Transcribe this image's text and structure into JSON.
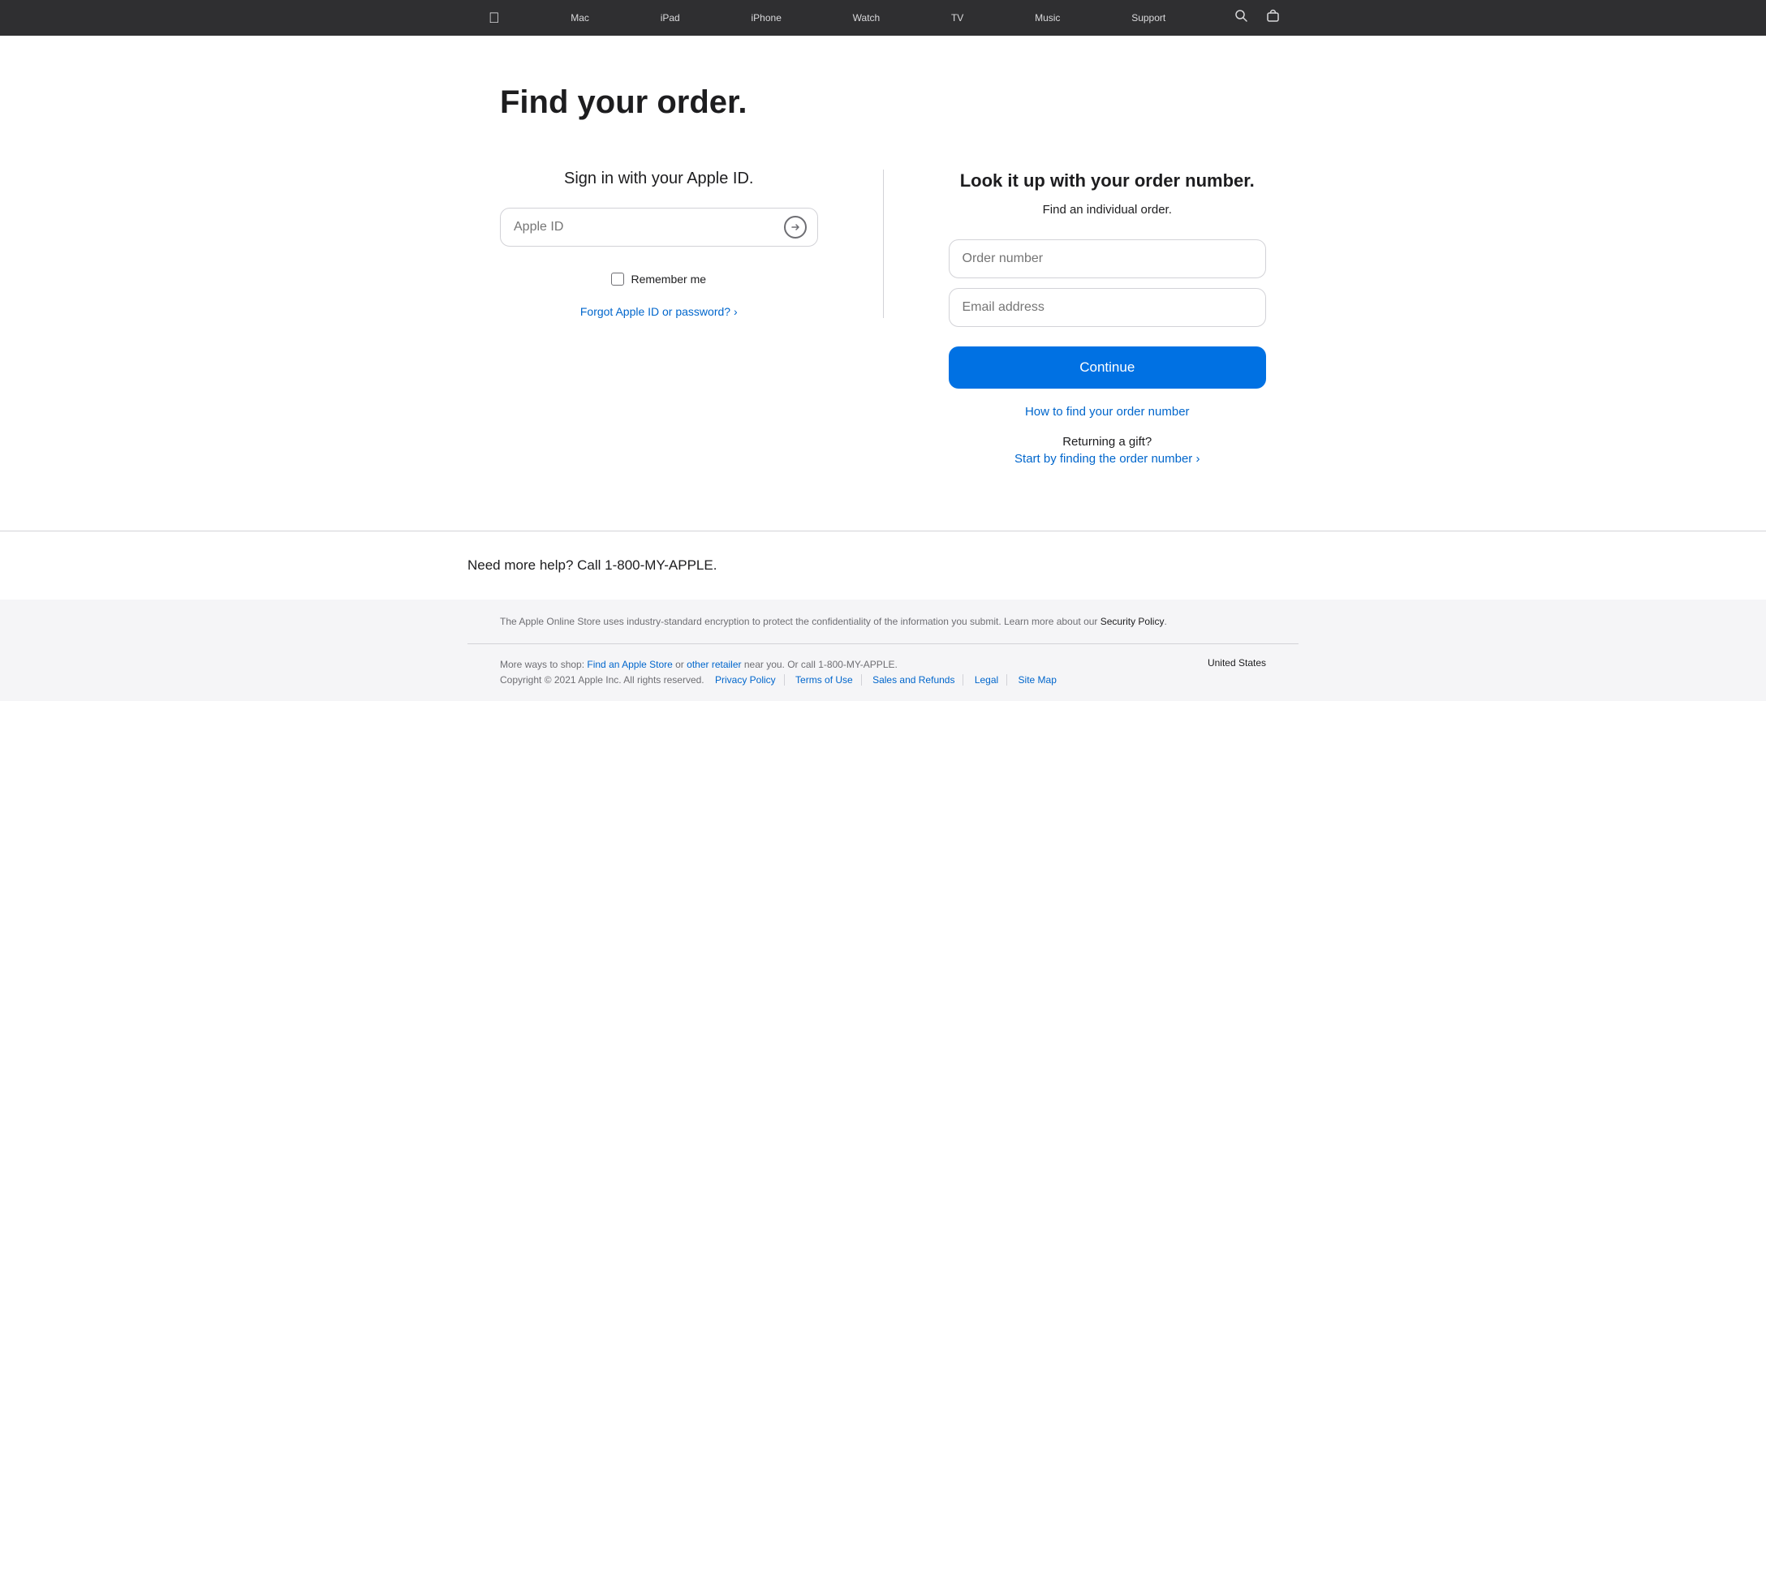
{
  "nav": {
    "apple_icon": "🍎",
    "items": [
      {
        "label": "Mac",
        "id": "mac"
      },
      {
        "label": "iPad",
        "id": "ipad"
      },
      {
        "label": "iPhone",
        "id": "iphone"
      },
      {
        "label": "Watch",
        "id": "watch"
      },
      {
        "label": "TV",
        "id": "tv"
      },
      {
        "label": "Music",
        "id": "music"
      },
      {
        "label": "Support",
        "id": "support"
      }
    ],
    "search_icon": "search",
    "bag_icon": "bag"
  },
  "page": {
    "title": "Find your order."
  },
  "left": {
    "sign_in_title": "Sign in with your Apple ID.",
    "apple_id_placeholder": "Apple ID",
    "remember_me_label": "Remember me",
    "forgot_link": "Forgot Apple ID or password? ›"
  },
  "right": {
    "lookup_title": "Look it up with your order number.",
    "lookup_sub": "Find an individual order.",
    "order_number_placeholder": "Order number",
    "email_placeholder": "Email address",
    "continue_label": "Continue",
    "how_to_link": "How to find your order number",
    "returning_gift_title": "Returning a gift?",
    "start_finding_link": "Start by finding the order number ›"
  },
  "footer_help": {
    "text": "Need more help? Call 1-800-MY-APPLE."
  },
  "footer": {
    "security_text_before": "The Apple Online Store uses industry-standard encryption to protect the confidentiality of the information you submit. Learn more about our ",
    "security_link": "Security Policy",
    "security_text_after": ".",
    "more_ways_before": "More ways to shop: ",
    "find_store_link": "Find an Apple Store",
    "more_ways_middle": " or ",
    "other_retailer_link": "other retailer",
    "more_ways_after": " near you. Or call 1-800-MY-APPLE.",
    "copyright": "Copyright © 2021 Apple Inc. All rights reserved.",
    "links": [
      {
        "label": "Privacy Policy"
      },
      {
        "label": "Terms of Use"
      },
      {
        "label": "Sales and Refunds"
      },
      {
        "label": "Legal"
      },
      {
        "label": "Site Map"
      }
    ],
    "region": "United States"
  }
}
